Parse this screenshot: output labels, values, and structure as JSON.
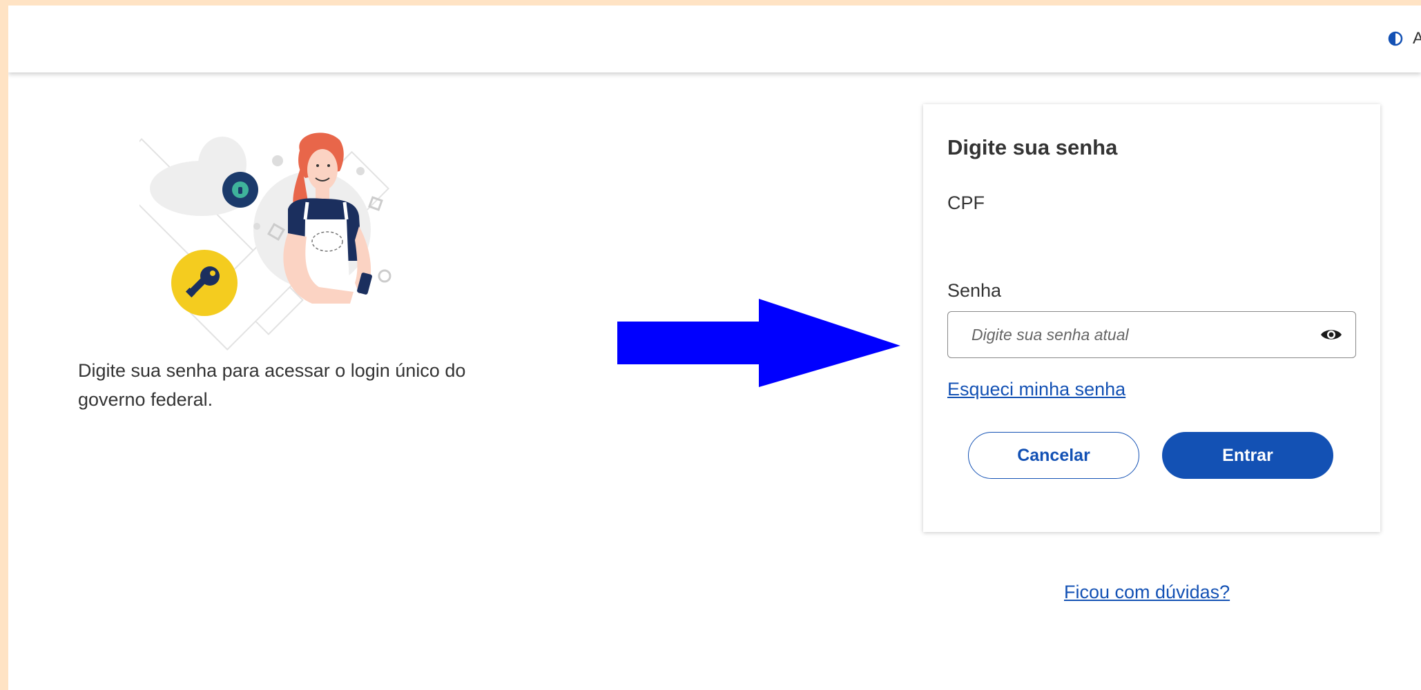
{
  "header": {
    "contrast_icon": "contrast-icon",
    "truncated_text": "A"
  },
  "intro": {
    "text": "Digite sua senha para acessar o login único do governo federal."
  },
  "card": {
    "title": "Digite sua senha",
    "cpf_label": "CPF",
    "cpf_value": "",
    "password_label": "Senha",
    "password_placeholder": "Digite sua senha atual",
    "password_value": "",
    "show_password_icon": "eye-icon",
    "forgot_link": "Esqueci minha senha",
    "cancel_label": "Cancelar",
    "enter_label": "Entrar"
  },
  "help_link": "Ficou com dúvidas?",
  "colors": {
    "primary": "#1351b4",
    "frame_background": "#ffe3c4",
    "annotation_arrow": "#0000ff",
    "key_badge": "#f4cc1f"
  }
}
